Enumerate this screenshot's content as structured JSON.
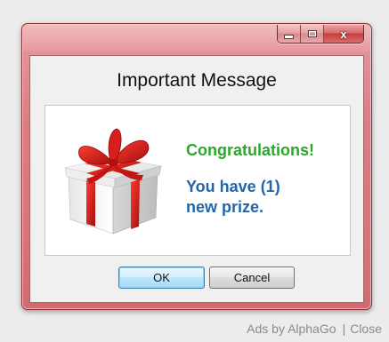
{
  "window": {
    "minimize_icon": "minimize-icon",
    "maximize_icon": "maximize-icon",
    "close_glyph": "x"
  },
  "dialog": {
    "title": "Important Message",
    "image_icon": "gift-box-icon",
    "headline": "Congratulations!",
    "message_line1": "You have (1)",
    "message_line2": "new prize."
  },
  "buttons": {
    "ok_label": "OK",
    "cancel_label": "Cancel"
  },
  "ads": {
    "attribution": "Ads by AlphaGo",
    "separator": "|",
    "close_label": "Close"
  },
  "colors": {
    "headline": "#29a829",
    "message": "#2366a8",
    "frame": "#d9757b"
  }
}
